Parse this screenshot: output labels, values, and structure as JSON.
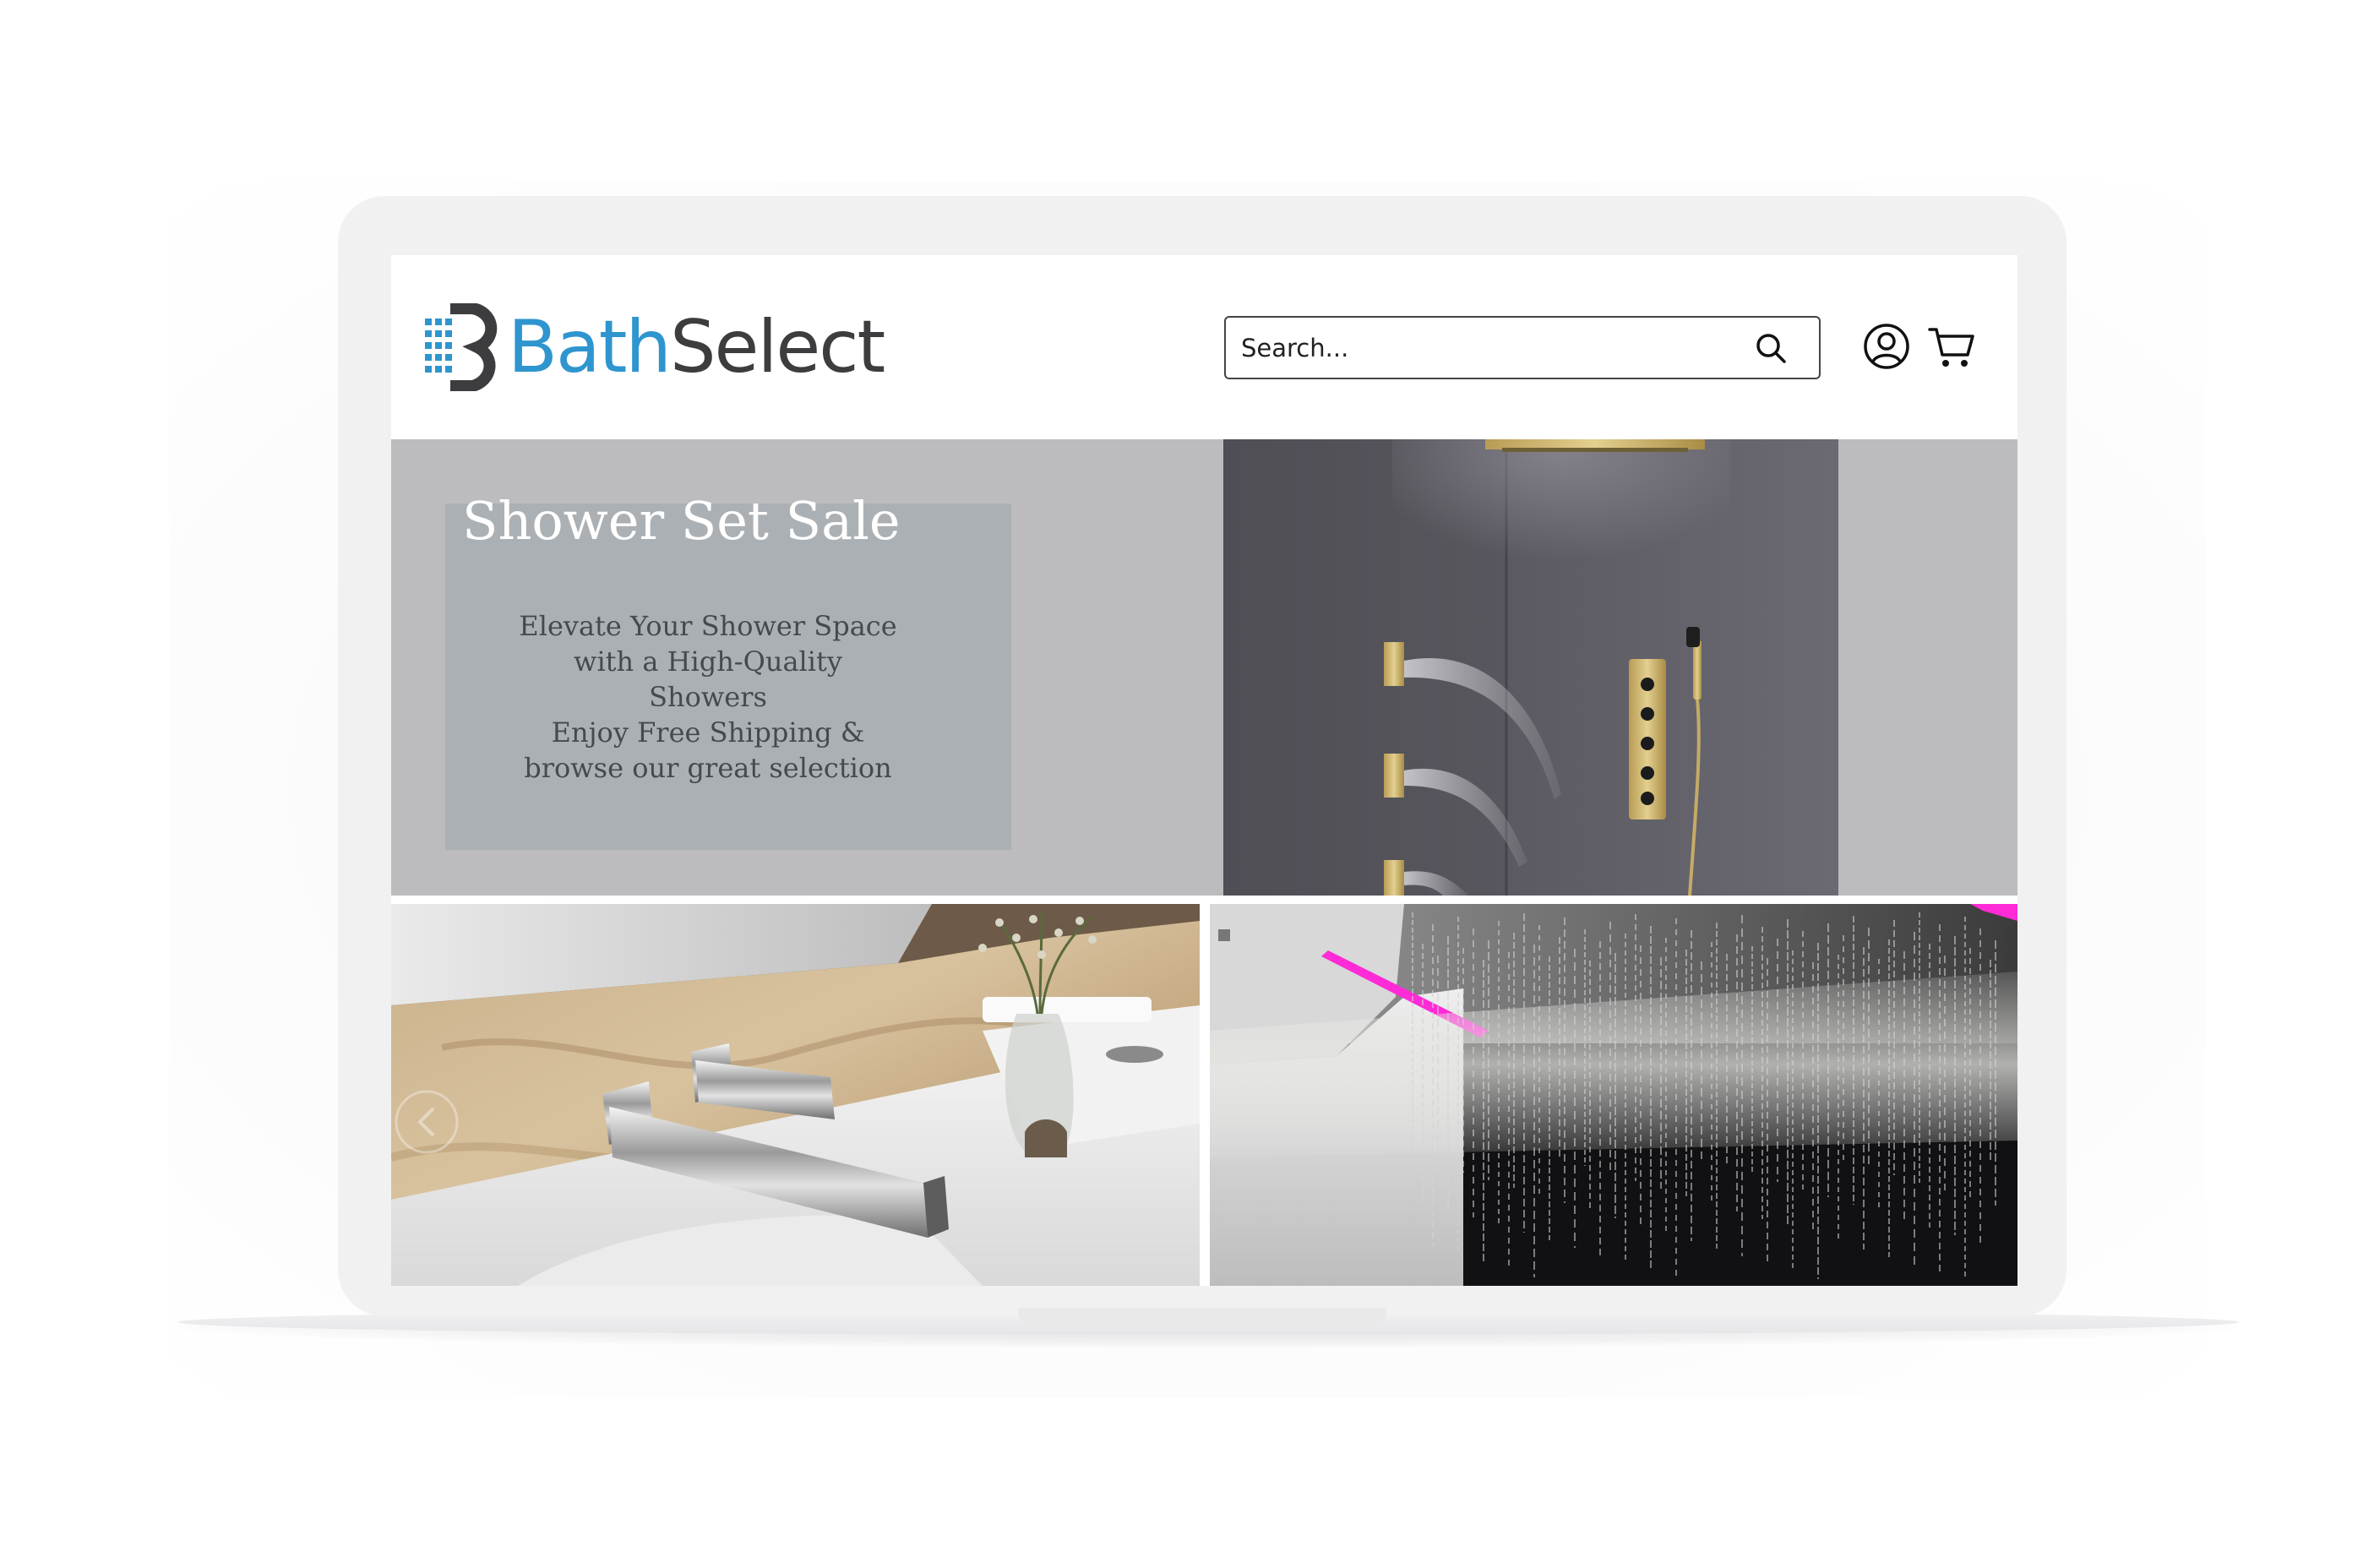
{
  "brand": {
    "logo_bath": "Bath",
    "logo_select": "Select",
    "colors": {
      "bath_blue": "#2e95cf",
      "select_gray": "#3d3d3f"
    }
  },
  "header": {
    "search": {
      "placeholder": "Search..."
    },
    "icons": [
      "search-icon",
      "account-icon",
      "cart-icon"
    ]
  },
  "hero": {
    "title": "Shower Set Sale",
    "subtitle_lines": [
      "Elevate Your Shower Space",
      "with a High-Quality",
      "Showers",
      "Enjoy Free Shipping &",
      "browse our great selection"
    ],
    "colors": {
      "band": "#bcbbbe",
      "text_box": "#abb0b4"
    }
  },
  "tiles": [
    {
      "name": "wall-faucet-tile"
    },
    {
      "name": "rain-shower-tile"
    }
  ]
}
